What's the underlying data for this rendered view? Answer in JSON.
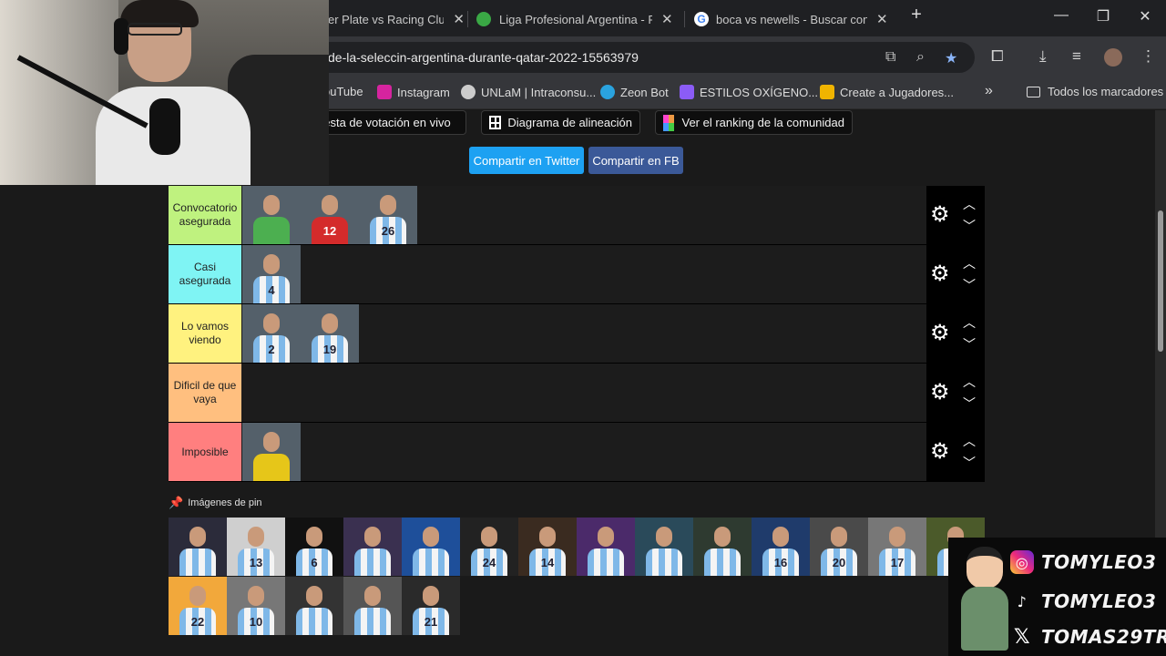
{
  "tabs": [
    {
      "title": "er Plate vs Racing Club",
      "close": "✕"
    },
    {
      "title": "Liga Profesional Argentina - PO",
      "close": "✕"
    },
    {
      "title": "boca vs newells - Buscar con Go",
      "close": "✕"
    }
  ],
  "new_tab": "+",
  "window_controls": {
    "minimize": "—",
    "restore": "❐",
    "close": "✕"
  },
  "address": {
    "url": "de-la-seleccin-argentina-durante-qatar-2022-15563979"
  },
  "bookmarks": [
    {
      "label": "ouTube",
      "icon": "youtube-icon",
      "color": "#ff0000"
    },
    {
      "label": "Instagram",
      "icon": "instagram-icon",
      "color": "#d6249f"
    },
    {
      "label": "UNLaM | Intraconsu...",
      "icon": "unlam-icon",
      "color": "#cccccc"
    },
    {
      "label": "Zeon Bot",
      "icon": "telegram-icon",
      "color": "#2aa3df"
    },
    {
      "label": "ESTILOS OXÍGENO...",
      "icon": "heart-icon",
      "color": "#8b5cf6"
    },
    {
      "label": "Create a Jugadores...",
      "icon": "grid-icon",
      "color": "#f0b400"
    }
  ],
  "bookmarks_more": "»",
  "all_bookmarks": "Todos los marcadores",
  "toolbar": {
    "vote_button": "uesta de votación en vivo",
    "lineup_button": "Diagrama de alineación",
    "ranking_button": "Ver el ranking de la comunidad",
    "share_twitter": "Compartir en Twitter",
    "share_fb": "Compartir en FB"
  },
  "tiers": [
    {
      "label": "Convocatorio asegurada",
      "color": "#bff27f",
      "players": [
        {
          "num": "",
          "jersey": "#4caf50"
        },
        {
          "num": "12",
          "jersey": "#d42b2b"
        },
        {
          "num": "26",
          "jersey": "stripes"
        }
      ]
    },
    {
      "label": "Casi asegurada",
      "color": "#7ff4f4",
      "players": [
        {
          "num": "4",
          "jersey": "stripes"
        }
      ]
    },
    {
      "label": "Lo vamos viendo",
      "color": "#fff27f",
      "players": [
        {
          "num": "2",
          "jersey": "stripes"
        },
        {
          "num": "19",
          "jersey": "stripes"
        }
      ]
    },
    {
      "label": "Dificil de que vaya",
      "color": "#ffbf7f",
      "players": []
    },
    {
      "label": "Imposible",
      "color": "#ff7f7f",
      "players": [
        {
          "num": "",
          "jersey": "#e6c619"
        }
      ]
    }
  ],
  "pins_title": "Imágenes de pin",
  "pins": [
    {
      "num": "",
      "bg": "#2b2b3a"
    },
    {
      "num": "13",
      "bg": "#cfcfcf"
    },
    {
      "num": "6",
      "bg": "#111111"
    },
    {
      "num": "",
      "bg": "#3a3050"
    },
    {
      "num": "",
      "bg": "#1e4f9a"
    },
    {
      "num": "24",
      "bg": "#222222"
    },
    {
      "num": "14",
      "bg": "#3a2b20"
    },
    {
      "num": "",
      "bg": "#4b2a6a"
    },
    {
      "num": "",
      "bg": "#2a4a5a"
    },
    {
      "num": "",
      "bg": "#2e3a30"
    },
    {
      "num": "16",
      "bg": "#1f3b6b"
    },
    {
      "num": "20",
      "bg": "#4a4a4a"
    },
    {
      "num": "17",
      "bg": "#777777"
    },
    {
      "num": "",
      "bg": "#4b5a2a"
    },
    {
      "num": "22",
      "bg": "#f2a83b"
    },
    {
      "num": "10",
      "bg": "#777777"
    },
    {
      "num": "",
      "bg": "#333333"
    },
    {
      "num": "",
      "bg": "#555555"
    },
    {
      "num": "21",
      "bg": "#2a2a2a"
    }
  ],
  "social": [
    {
      "handle": "TOMYLEO3",
      "icon": "instagram-icon"
    },
    {
      "handle": "TOMYLEO3",
      "icon": "tiktok-icon"
    },
    {
      "handle": "TOMAS29TR",
      "icon": "x-icon"
    }
  ]
}
